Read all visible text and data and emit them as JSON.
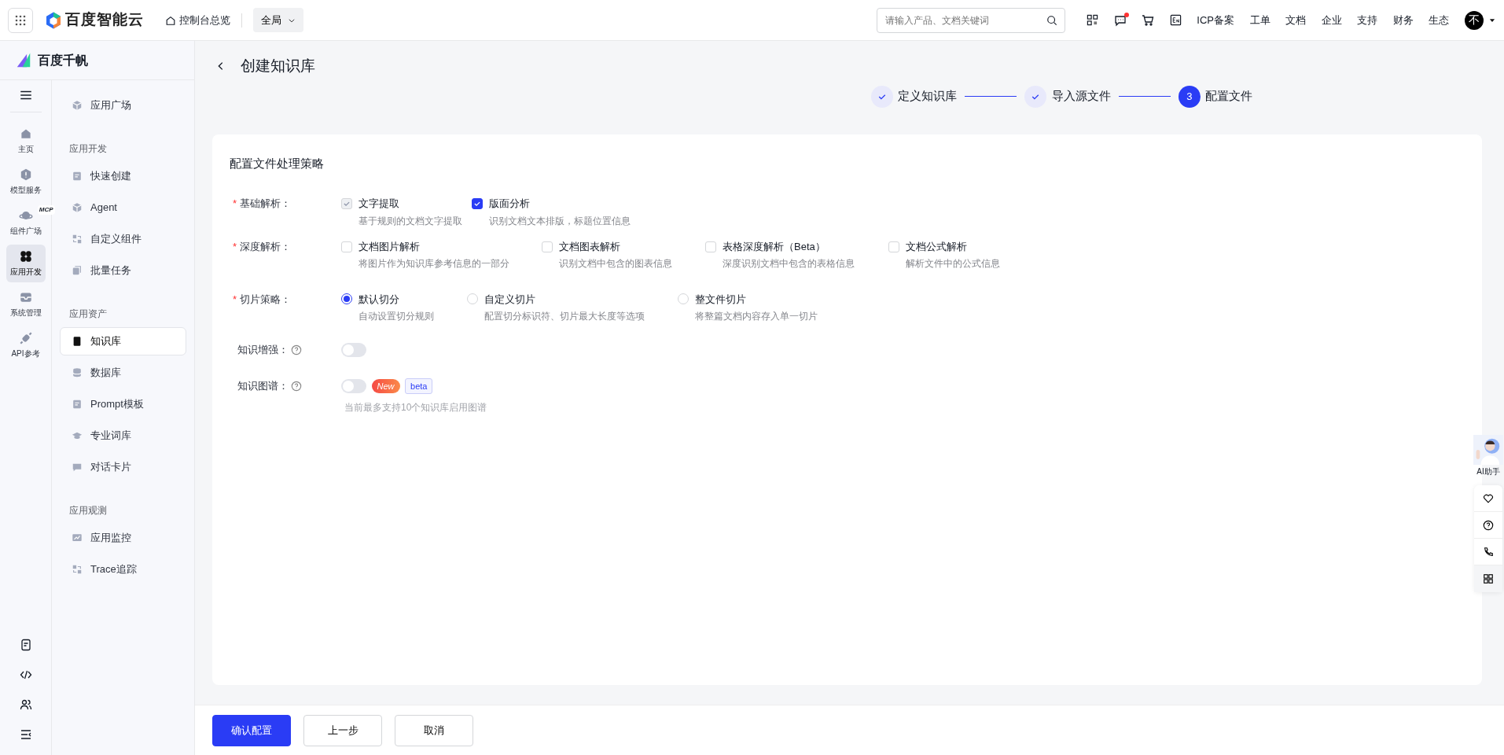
{
  "topbar": {
    "brand": "百度智能云",
    "overview": "控制台总览",
    "region": "全局",
    "search": {
      "placeholder": "请输入产品、文档关键词"
    },
    "links": [
      "ICP备案",
      "工单",
      "文档",
      "企业",
      "支持",
      "财务",
      "生态"
    ],
    "avatar": "不",
    "has_message_dot": true
  },
  "product": {
    "name": "百度千帆"
  },
  "rail": [
    {
      "label": "主页",
      "selected": false
    },
    {
      "label": "模型服务",
      "selected": false
    },
    {
      "label": "组件广场",
      "selected": false,
      "badge": "MCP"
    },
    {
      "label": "应用开发",
      "selected": true
    },
    {
      "label": "系统管理",
      "selected": false
    },
    {
      "label": "API参考",
      "selected": false
    }
  ],
  "sidebar": [
    {
      "kind": "item",
      "label": "应用广场",
      "selected": false
    },
    {
      "kind": "group",
      "label": "应用开发"
    },
    {
      "kind": "item",
      "label": "快速创建",
      "selected": false
    },
    {
      "kind": "item",
      "label": "Agent",
      "selected": false
    },
    {
      "kind": "item",
      "label": "自定义组件",
      "selected": false
    },
    {
      "kind": "item",
      "label": "批量任务",
      "selected": false
    },
    {
      "kind": "group",
      "label": "应用资产"
    },
    {
      "kind": "item",
      "label": "知识库",
      "selected": true
    },
    {
      "kind": "item",
      "label": "数据库",
      "selected": false
    },
    {
      "kind": "item",
      "label": "Prompt模板",
      "selected": false
    },
    {
      "kind": "item",
      "label": "专业词库",
      "selected": false
    },
    {
      "kind": "item",
      "label": "对话卡片",
      "selected": false
    },
    {
      "kind": "group",
      "label": "应用观测"
    },
    {
      "kind": "item",
      "label": "应用监控",
      "selected": false
    },
    {
      "kind": "item",
      "label": "Trace追踪",
      "selected": false
    }
  ],
  "page": {
    "title": "创建知识库"
  },
  "steps": [
    {
      "label": "定义知识库",
      "done": true
    },
    {
      "label": "导入源文件",
      "done": true
    },
    {
      "label": "配置文件",
      "marker": "3",
      "done": false
    }
  ],
  "form": {
    "title": "配置文件处理策略",
    "basic": {
      "label": "基础解析：",
      "required_mark": "*",
      "options": [
        {
          "label": "文字提取",
          "desc": "基于规则的文档文字提取",
          "checked": true,
          "disabled": true
        },
        {
          "label": "版面分析",
          "desc": "识别文档文本排版，标题位置信息",
          "checked": true,
          "disabled": false
        }
      ]
    },
    "deep": {
      "label": "深度解析：",
      "required_mark": "*",
      "options": [
        {
          "label": "文档图片解析",
          "desc": "将图片作为知识库参考信息的一部分",
          "checked": false,
          "disabled": false
        },
        {
          "label": "文档图表解析",
          "desc": "识别文档中包含的图表信息",
          "checked": false,
          "disabled": false
        },
        {
          "label": "表格深度解析（Beta）",
          "desc": "深度识别文档中包含的表格信息",
          "checked": false,
          "disabled": false
        },
        {
          "label": "文档公式解析",
          "desc": "解析文件中的公式信息",
          "checked": false,
          "disabled": false
        }
      ]
    },
    "chunk": {
      "label": "切片策略：",
      "required_mark": "*",
      "options": [
        {
          "label": "默认切分",
          "desc": "自动设置切分规则",
          "selected": true
        },
        {
          "label": "自定义切片",
          "desc": "配置切分标识符、切片最大长度等选项",
          "selected": false
        },
        {
          "label": "整文件切片",
          "desc": "将整篇文档内容存入单一切片",
          "selected": false
        }
      ]
    },
    "enhance": {
      "label": "知识增强：",
      "on": false
    },
    "graph": {
      "label": "知识图谱：",
      "on": false,
      "tags": [
        "New",
        "beta"
      ],
      "note": "当前最多支持10个知识库启用图谱"
    }
  },
  "buttons": [
    "确认配置",
    "上一步",
    "取消"
  ],
  "assistant": {
    "label": "AI助手"
  }
}
